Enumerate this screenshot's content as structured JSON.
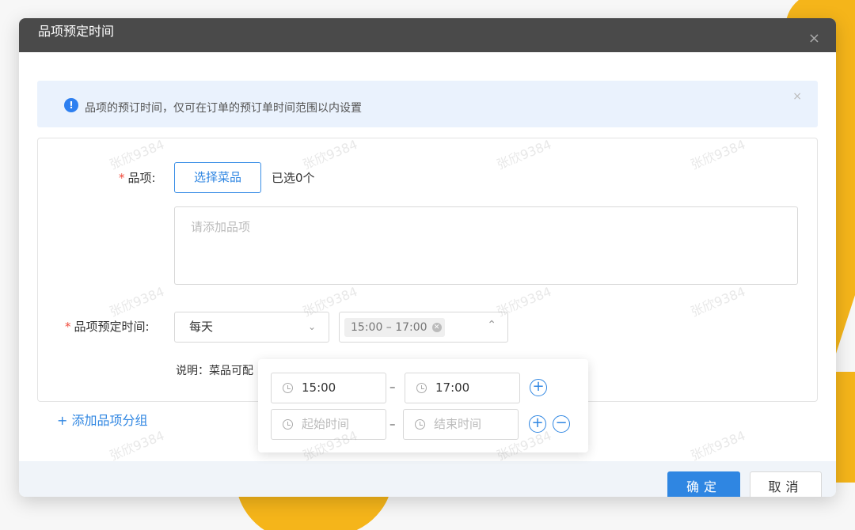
{
  "modal": {
    "title": "品项预定时间",
    "close_glyph": "×"
  },
  "alert": {
    "icon_glyph": "!",
    "text": "品项的预订时间，仅可在订单的预订单时间范围以内设置",
    "close_glyph": "×"
  },
  "form": {
    "item": {
      "required_mark": "*",
      "label": "品项:",
      "select_button": "选择菜品",
      "selected_count": "已选0个",
      "textarea_placeholder": "请添加品项"
    },
    "schedule": {
      "required_mark": "*",
      "label": "品项预定时间:",
      "frequency_value": "每天",
      "time_tag": "15:00 – 17:00",
      "note": "说明：菜品可配"
    }
  },
  "time_popover": {
    "rows": [
      {
        "start": "15:00",
        "end": "17:00",
        "separator": "–",
        "add_glyph": "+"
      },
      {
        "start_placeholder": "起始时间",
        "end_placeholder": "结束时间",
        "separator": "–",
        "add_glyph": "+",
        "remove_glyph": "−"
      }
    ]
  },
  "add_group": "+ 添加品项分组",
  "footer": {
    "ok": "确定",
    "cancel": "取消"
  },
  "watermark": "张欣9384",
  "colors": {
    "primary": "#2f86e2",
    "header_bg": "#4a4a4a",
    "accent_yellow": "#f5b51a",
    "required": "#f04b3c"
  }
}
